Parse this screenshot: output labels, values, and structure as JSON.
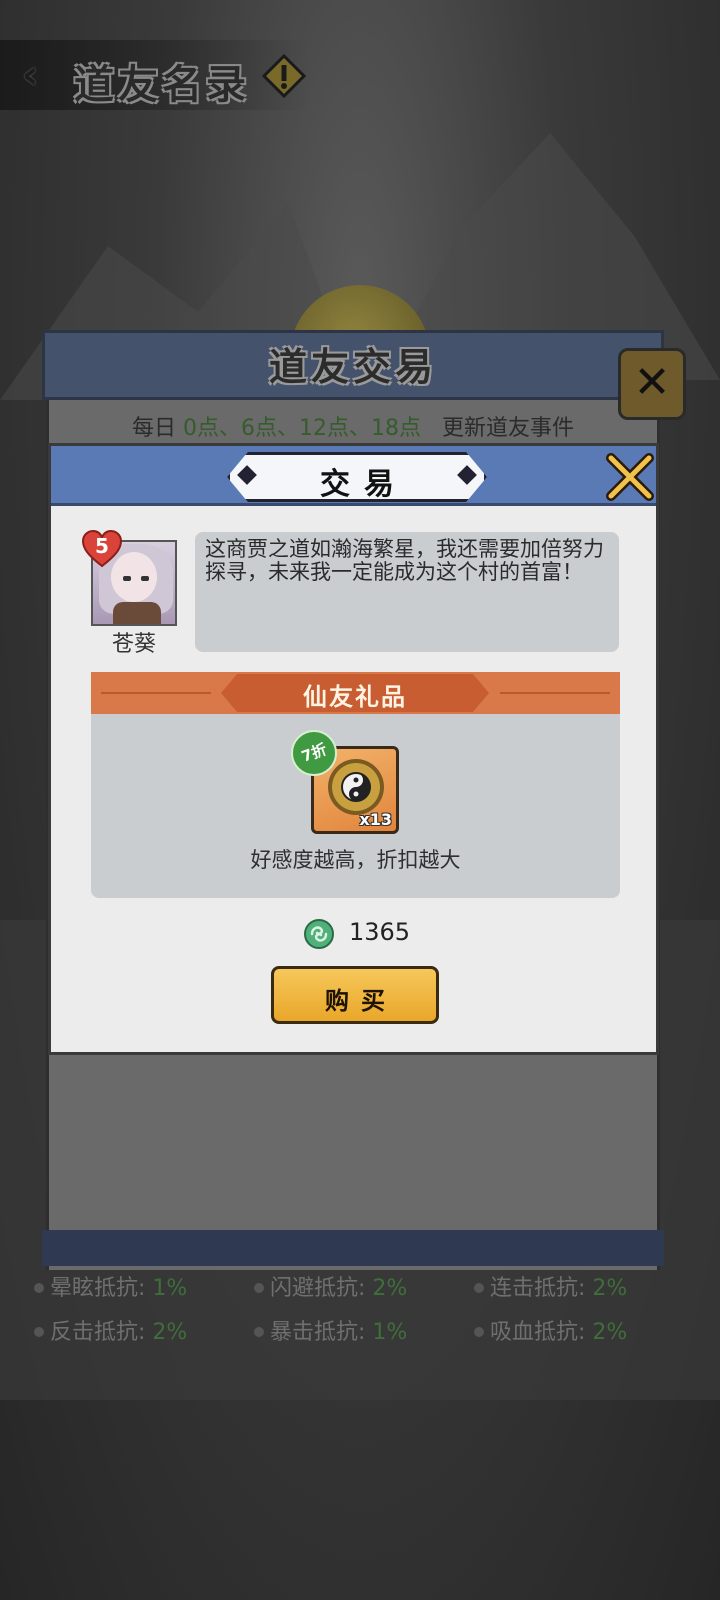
{
  "header": {
    "title": "道友名录"
  },
  "outer_dialog": {
    "title": "道友交易",
    "update_prefix": "每日",
    "update_times": "0点、6点、12点、18点",
    "update_suffix": "更新道友事件"
  },
  "trade_dialog": {
    "title": "交易",
    "npc": {
      "name": "苍葵",
      "favor_level": "5",
      "speech": "这商贾之道如瀚海繁星，我还需要加倍努力探寻，未来我一定能成为这个村的首富！"
    },
    "gift": {
      "section_title": "仙友礼品",
      "discount": "7折",
      "item_count": "x13",
      "hint": "好感度越高，折扣越大"
    },
    "price": "1365",
    "buy_label": "购买"
  },
  "background_stats": [
    [
      {
        "label": "晕眩抵抗: ",
        "value": "1%"
      },
      {
        "label": "闪避抵抗: ",
        "value": "2%"
      },
      {
        "label": "连击抵抗: ",
        "value": "2%"
      }
    ],
    [
      {
        "label": "反击抵抗: ",
        "value": "2%"
      },
      {
        "label": "暴击抵抗: ",
        "value": "1%"
      },
      {
        "label": "吸血抵抗: ",
        "value": "2%"
      }
    ]
  ],
  "icons": {
    "back": "chevron-left-icon",
    "warning": "warning-diamond-icon",
    "close": "crossed-swords-close-icon",
    "currency": "jade-coin-icon",
    "item": "yinyang-token-icon"
  },
  "colors": {
    "header_blue": "#5a7ab6",
    "gift_orange": "#d9794a",
    "buy_gold": "#f6c75a",
    "discount_green": "#3f9a42",
    "highlight_green": "#355c2c"
  }
}
